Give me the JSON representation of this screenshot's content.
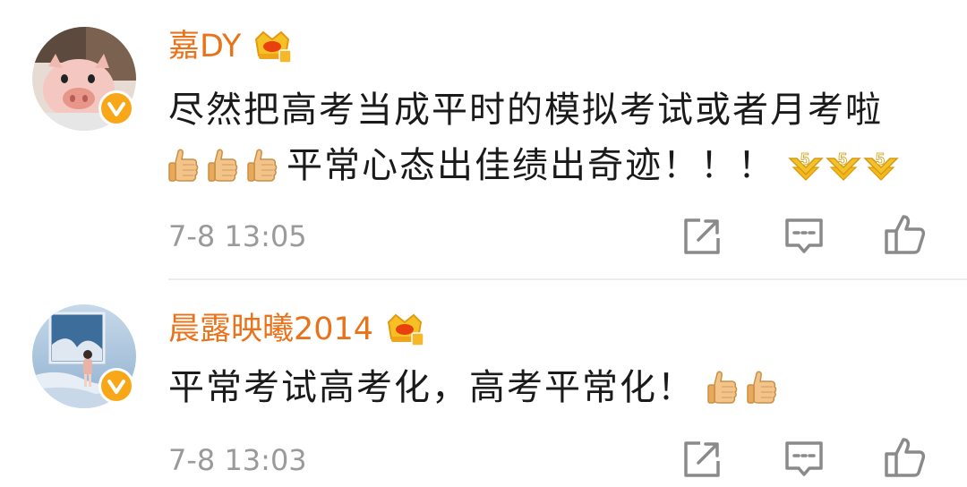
{
  "comments": [
    {
      "username": "嘉DY",
      "badge_level": "6",
      "lines": [
        "尽然把高考当成平时的模拟考试或者月考啦",
        "平常心态出佳绩出奇迹！！！"
      ],
      "timestamp": "7-8 13:05",
      "emojis": [
        "thumbs-up",
        "thumbs-up",
        "thumbs-up",
        "five",
        "five",
        "five"
      ]
    },
    {
      "username": "晨露映曦2014",
      "badge_level": "6",
      "lines": [
        "平常考试高考化，高考平常化！"
      ],
      "timestamp": "7-8 13:03",
      "emojis": [
        "thumbs-up",
        "thumbs-up"
      ]
    }
  ],
  "colors": {
    "username": "#e8731a",
    "text": "#1a1a1a",
    "timestamp": "#9a9a9a",
    "verified_badge": "#f7a718",
    "icon": "#8a8a8a"
  },
  "icons": [
    "share-icon",
    "comment-icon",
    "like-icon",
    "crown-badge-icon",
    "verified-icon"
  ]
}
